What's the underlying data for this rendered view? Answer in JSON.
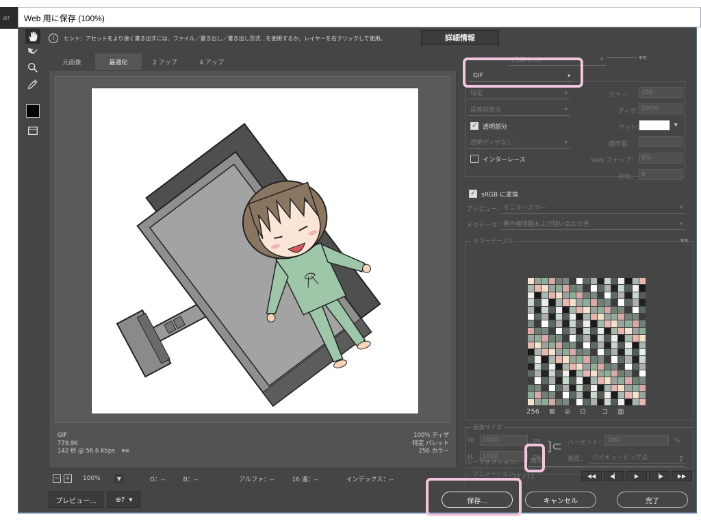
{
  "window": {
    "title": "Web 用に保存 (100%)",
    "left_edge_glyph": "ar"
  },
  "hint": {
    "icon": "info-icon",
    "text": "ヒント：アセットをより速く書き出すには、ファイル／書き出し／書き出し形式...を使用するか、レイヤーを右クリックして使用。",
    "detail_button": "詳細情報"
  },
  "tabs": [
    {
      "label": "元画像",
      "active": false
    },
    {
      "label": "最適化",
      "active": true
    },
    {
      "label": "2 アップ",
      "active": false
    },
    {
      "label": "4 アップ",
      "active": false
    }
  ],
  "image_info": {
    "format": "GIF",
    "size": "779.9K",
    "time": "142 秒 @ 56.6 Kbps",
    "dither": "100% ディザ",
    "palette": "特定 パレット",
    "colors": "256 カラー"
  },
  "statusbar": {
    "zoom": "100%",
    "g": "G：--",
    "b": "B：--",
    "alpha": "アルファ：--",
    "hex": "16 進：--",
    "index": "インデックス：--"
  },
  "bottom": {
    "preview_button": "プレビュー...",
    "save_button": "保存...",
    "cancel_button": "キャンセル",
    "done_button": "完了"
  },
  "settings": {
    "preset": "[名前なし]",
    "format": "GIF",
    "reduction": "特定",
    "dither_algo": "誤差拡散法",
    "transparency_label": "透明部分",
    "transparency_checked": true,
    "trans_dither": "透明ディザなし",
    "interlace_label": "インターレース",
    "interlace_checked": false,
    "colors_label": "カラー：",
    "colors_value": "256",
    "dither_label": "ディザ：",
    "dither_value": "100%",
    "matte_label": "マット：",
    "amount_label": "適用量：",
    "websnap_label": "Web スナップ：",
    "websnap_value": "0%",
    "lossy_label": "劣化：",
    "lossy_value": "0",
    "srgb_label": "sRGB に変換",
    "srgb_checked": true,
    "preview_label": "プレビュー：",
    "preview_value": "モニターカラー",
    "metadata_label": "メタデータ：",
    "metadata_value": "著作権情報および問い合わせ先"
  },
  "color_table": {
    "title": "カラーテーブル",
    "count": "256"
  },
  "image_size": {
    "title": "画像サイズ",
    "w_label": "W:",
    "w_value": "1000",
    "h_label": "H:",
    "h_value": "1000",
    "unit": "px",
    "percent_label": "パーセント：",
    "percent_value": "100",
    "percent_unit": "%",
    "quality_label": "画質：",
    "quality_value": "バイキュービック法"
  },
  "animation": {
    "title": "アニメーション",
    "loop_label": "ループオプション：",
    "loop_value": "無限",
    "frame": "11 / 11"
  }
}
